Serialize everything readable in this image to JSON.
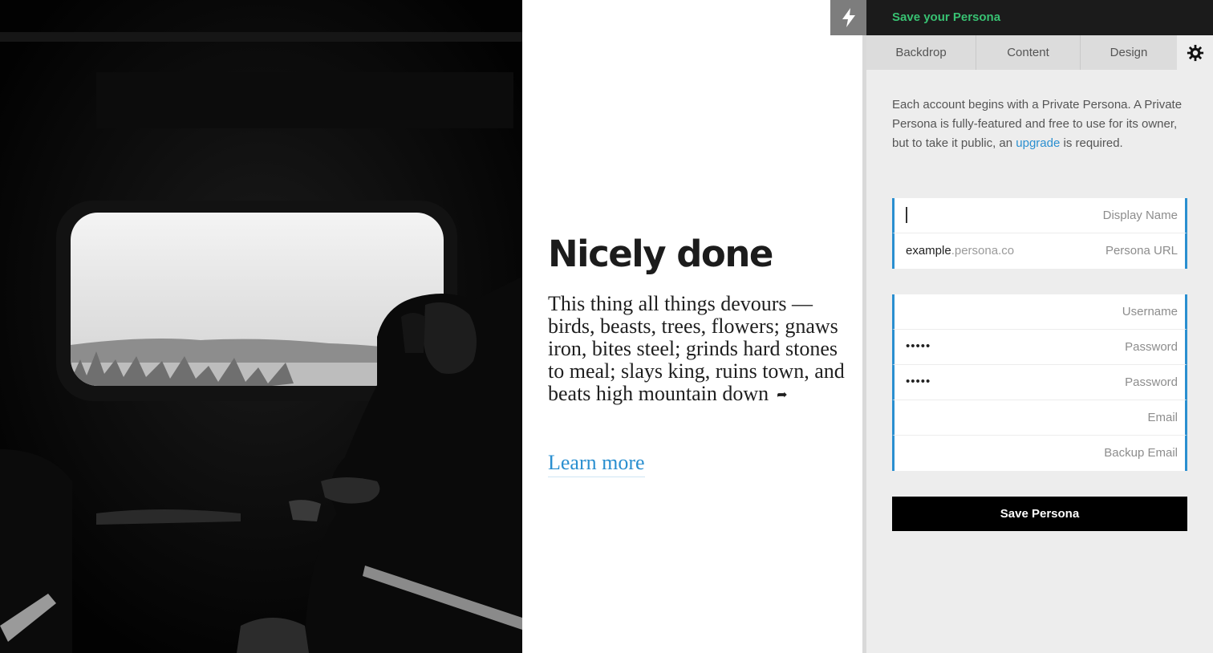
{
  "app": {
    "title": "Save your Persona",
    "accent_color": "#38c172",
    "link_color": "#2a8fd0",
    "bolt_icon": "lightning-icon",
    "settings_icon": "gear-icon"
  },
  "tabs": [
    {
      "label": "Backdrop"
    },
    {
      "label": "Content"
    },
    {
      "label": "Design"
    }
  ],
  "hero": {
    "headline": "Nicely done",
    "body": "This thing all things devours — birds, beasts, trees, flowers; gnaws iron, bites steel; grinds hard stones to meal; slays king, ruins town, and beats high mountain down",
    "share_icon": "share-arrow-icon",
    "link_label": "Learn more"
  },
  "intro": {
    "text_before": "Each account begins with a Private Persona. A Private Persona is fully-featured and free to use for its owner, but to take it public, an ",
    "link": "upgrade",
    "text_after": " is required."
  },
  "fields": {
    "display_name": {
      "value": "",
      "label": "Display Name"
    },
    "persona_url": {
      "value": "example",
      "suffix": ".persona.co",
      "label": "Persona URL"
    },
    "username": {
      "value": "",
      "label": "Username"
    },
    "password": {
      "value": "•••••",
      "label": "Password"
    },
    "password_confirm": {
      "value": "•••••",
      "label": "Password"
    },
    "email": {
      "value": "",
      "label": "Email"
    },
    "backup_email": {
      "value": "",
      "label": "Backup Email"
    }
  },
  "save_button": {
    "label": "Save Persona"
  }
}
